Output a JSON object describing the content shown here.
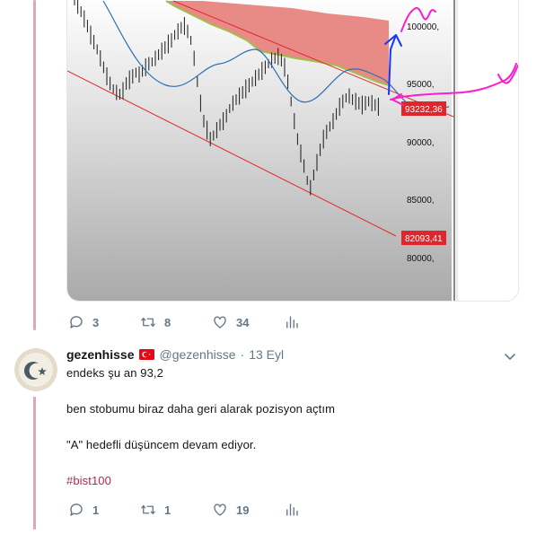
{
  "chart": {
    "price_labels": [
      "100000,",
      "95000,",
      "90000,",
      "85000,",
      "80000,"
    ],
    "price_tags": [
      {
        "text": "93232,36",
        "color": "#e0262a"
      },
      {
        "text": "82093,41",
        "color": "#e0262a"
      }
    ],
    "colors": {
      "background": "#b8b8b8",
      "channel_line": "#e3262a",
      "band_fill": "#e88a86",
      "moving_average": "#2c6fb3",
      "annotation_pink": "#ff1ccf",
      "annotation_blue": "#1437ff"
    }
  },
  "upper_tweet_actions": {
    "reply_count": "3",
    "retweet_count": "8",
    "like_count": "34"
  },
  "tweet": {
    "display_name": "gezenhisse",
    "handle": "@gezenhisse",
    "separator": "·",
    "date": "13 Eyl",
    "lines": [
      "endeks şu an 93,2",
      "ben stobumu biraz daha geri alarak pozisyon açtım",
      "\"A\" hedefli düşüncem devam ediyor."
    ],
    "hashtag": "#bist100",
    "reply_count": "1",
    "retweet_count": "1",
    "like_count": "19"
  },
  "icons": [
    "reply-icon",
    "retweet-icon",
    "like-icon",
    "analytics-icon",
    "chevron-down-icon",
    "turkey-flag-icon"
  ]
}
